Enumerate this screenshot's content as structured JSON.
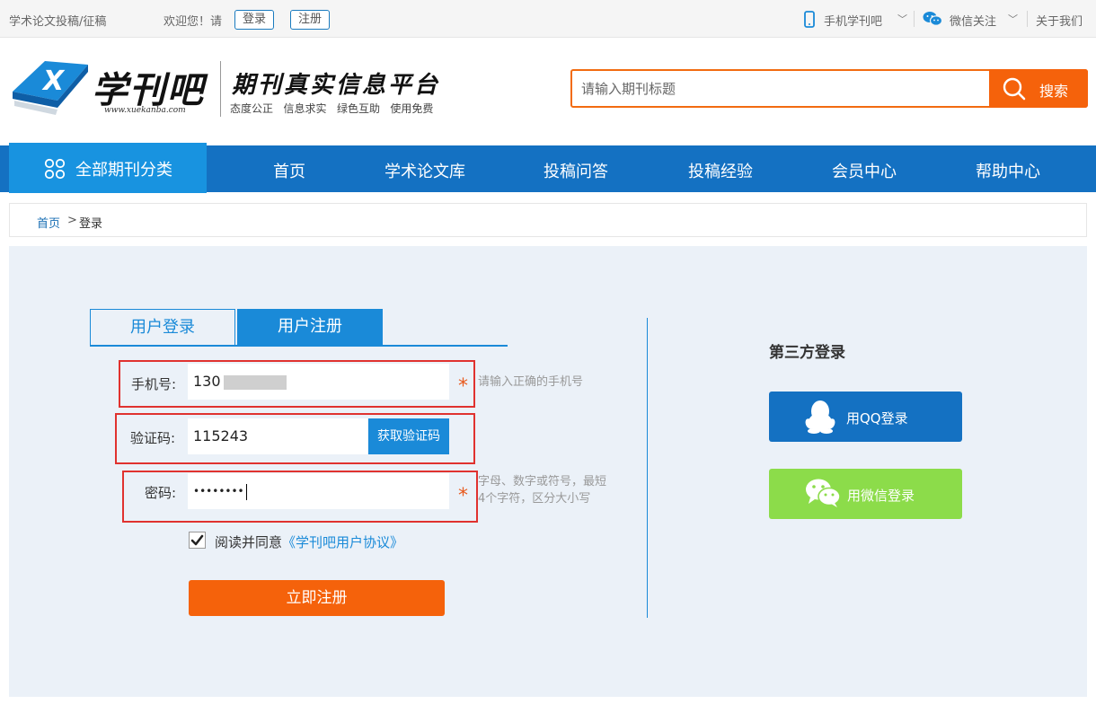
{
  "topbar": {
    "site_tag": "学术论文投稿/征稿",
    "welcome": "欢迎您！请",
    "login_label": "登录",
    "register_label": "注册",
    "mobile_label": "手机学刊吧",
    "wechat_label": "微信关注",
    "about_label": "关于我们"
  },
  "header": {
    "logo_name": "学刊吧",
    "logo_url": "www.xuekanba.com",
    "slogan": "期刊真实信息平台",
    "mottos": [
      "态度公正",
      "信息求实",
      "绿色互助",
      "使用免费"
    ],
    "search_placeholder": "请输入期刊标题",
    "search_label": "搜索"
  },
  "nav": {
    "all_label": "全部期刊分类",
    "items": [
      {
        "label": "首页"
      },
      {
        "label": "学术论文库"
      },
      {
        "label": "投稿问答"
      },
      {
        "label": "投稿经验"
      },
      {
        "label": "会员中心"
      },
      {
        "label": "帮助中心"
      }
    ]
  },
  "breadcrumb": {
    "home": "首页",
    "separator": ">",
    "current": "登录"
  },
  "tabs": {
    "login": "用户登录",
    "register": "用户注册"
  },
  "form": {
    "phone_label": "手机号:",
    "phone_value": "130",
    "phone_hint": "请输入正确的手机号",
    "code_label": "验证码:",
    "code_value": "115243",
    "code_button": "获取验证码",
    "password_label": "密码:",
    "password_value": "••••••••",
    "password_hint_line1": "字母、数字或符号，最短",
    "password_hint_line2": "4个字符，区分大小写",
    "required_mark": "*",
    "agree_text": "阅读并同意",
    "agree_link": "《学刊吧用户协议》",
    "agree_checked": true,
    "submit_label": "立即注册"
  },
  "third_party": {
    "title": "第三方登录",
    "qq_label": "用QQ登录",
    "wechat_label": "用微信登录"
  },
  "colors": {
    "primary_blue": "#1471c2",
    "light_blue": "#1a8ad8",
    "orange": "#f5620b",
    "highlight_red": "#e0322f",
    "wechat_green": "#8cdc4a",
    "panel_bg": "#ebf1f8"
  }
}
